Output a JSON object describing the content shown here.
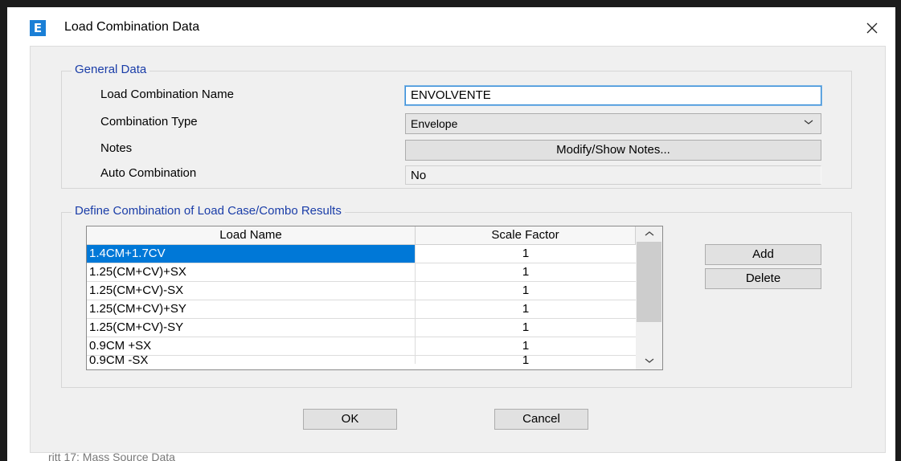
{
  "window": {
    "title": "Load Combination Data",
    "app_icon_letter": "E",
    "accent_color": "#1a7fd6",
    "background_peek_text": "ritt 17: Mass Source Data"
  },
  "general_data": {
    "group_title": "General Data",
    "name_label": "Load Combination Name",
    "name_value": "ENVOLVENTE",
    "type_label": "Combination Type",
    "type_value": "Envelope",
    "notes_label": "Notes",
    "notes_button": "Modify/Show Notes...",
    "auto_label": "Auto Combination",
    "auto_value": "No"
  },
  "combination": {
    "group_title": "Define Combination of Load Case/Combo Results",
    "columns": [
      "Load Name",
      "Scale Factor"
    ],
    "rows": [
      {
        "name": "1.4CM+1.7CV",
        "factor": "1"
      },
      {
        "name": "1.25(CM+CV)+SX",
        "factor": "1"
      },
      {
        "name": "1.25(CM+CV)-SX",
        "factor": "1"
      },
      {
        "name": "1.25(CM+CV)+SY",
        "factor": "1"
      },
      {
        "name": "1.25(CM+CV)-SY",
        "factor": "1"
      },
      {
        "name": "0.9CM +SX",
        "factor": "1"
      },
      {
        "name": "0.9CM -SX",
        "factor": "1"
      }
    ],
    "selected_row": 0,
    "add_button": "Add",
    "delete_button": "Delete"
  },
  "buttons": {
    "ok": "OK",
    "cancel": "Cancel"
  }
}
